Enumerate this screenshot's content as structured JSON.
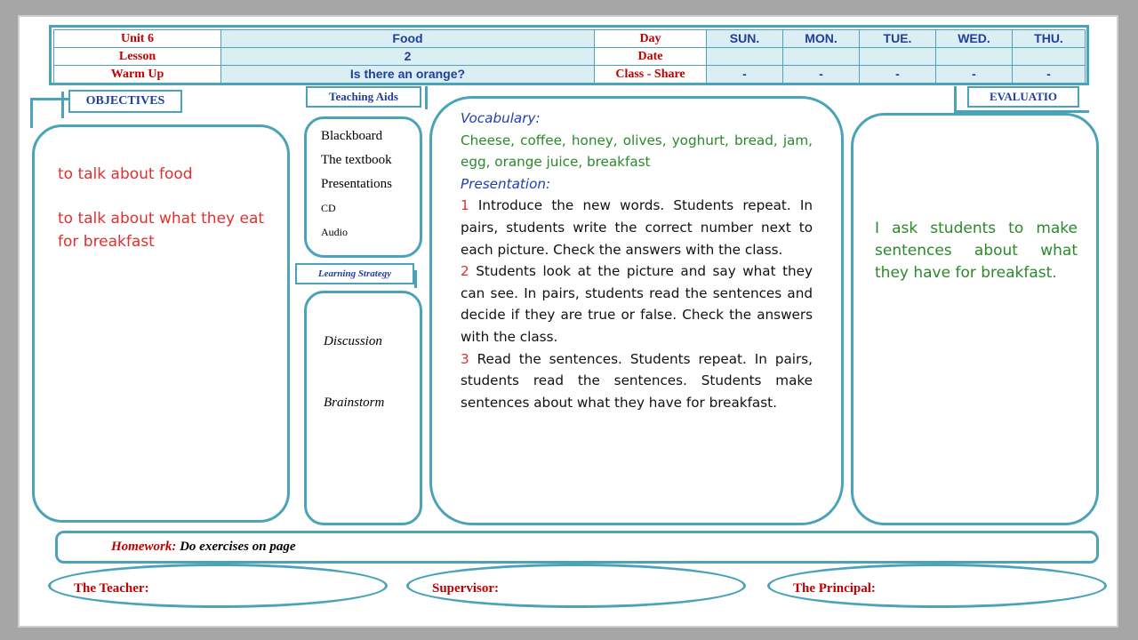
{
  "header": {
    "rows": [
      {
        "label": "Unit 6",
        "value": "Food",
        "meta": "Day"
      },
      {
        "label": "Lesson",
        "value": "2",
        "meta": "Date"
      },
      {
        "label": "Warm Up",
        "value": "Is there an orange?",
        "meta": "Class - Share"
      }
    ],
    "days": [
      "SUN.",
      "MON.",
      "TUE.",
      "WED.",
      "THU."
    ],
    "share_marks": [
      "-",
      "-",
      "-",
      "-",
      "-"
    ]
  },
  "objectives": {
    "title": "OBJECTIVES",
    "items": [
      "to talk about food",
      "to talk about what they eat for breakfast"
    ]
  },
  "teaching_aids": {
    "title": "Teaching Aids",
    "items": [
      "Blackboard",
      "The textbook",
      "Presentations",
      "CD",
      "Audio"
    ]
  },
  "learning_strategy": {
    "title": "Learning Strategy",
    "items": [
      "Discussion",
      "Brainstorm"
    ]
  },
  "lesson": {
    "vocab_heading": "Vocabulary:",
    "vocab_words": "Cheese, coffee, honey, olives, yoghurt, bread, jam, egg, orange juice, breakfast",
    "presentation_heading": "Presentation:",
    "steps": [
      {
        "num": "1",
        "text": "Introduce the new words. Students repeat. In pairs, students write the correct number next to each picture. Check the answers with the class."
      },
      {
        "num": "2",
        "text": "Students look at the picture and say what they can see. In pairs, students read the sentences and decide if they are true or false. Check the answers with the class."
      },
      {
        "num": "3",
        "text": "Read the sentences. Students repeat. In pairs, students read the sentences. Students make sentences about what they have for breakfast."
      }
    ]
  },
  "evaluation": {
    "title": "EVALUATIO",
    "text": "I ask students to make sentences about what they have for breakfast."
  },
  "homework": {
    "label": "Homework:",
    "text": "Do exercises on page"
  },
  "signatures": {
    "teacher": "The Teacher:",
    "supervisor": "Supervisor:",
    "principal": "The Principal:"
  },
  "colors": {
    "accent": "#4aa3b8",
    "label_red": "#c00000",
    "heading_blue": "#1f3f9a",
    "cell_fill": "#dbeef4",
    "eval_green": "#2a8a2a"
  }
}
